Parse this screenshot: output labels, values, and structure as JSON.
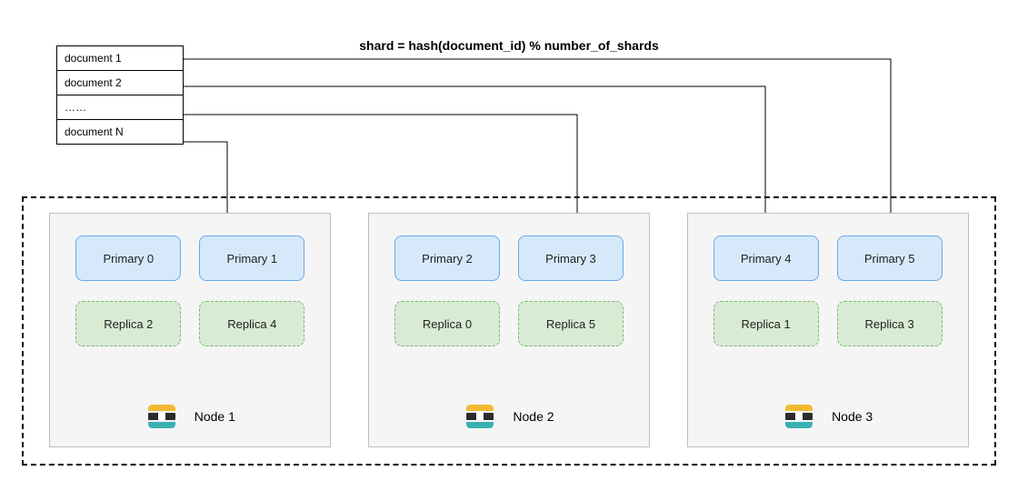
{
  "formula": "shard = hash(document_id) % number_of_shards",
  "documents": {
    "d1": "document 1",
    "d2": "document 2",
    "d3": "……",
    "d4": "document N"
  },
  "nodes": [
    {
      "label": "Node 1",
      "primaries": [
        "Primary 0",
        "Primary 1"
      ],
      "replicas": [
        "Replica 2",
        "Replica 4"
      ]
    },
    {
      "label": "Node 2",
      "primaries": [
        "Primary 2",
        "Primary 3"
      ],
      "replicas": [
        "Replica 0",
        "Replica 5"
      ]
    },
    {
      "label": "Node 3",
      "primaries": [
        "Primary 4",
        "Primary 5"
      ],
      "replicas": [
        "Replica 1",
        "Replica 3"
      ]
    }
  ],
  "logo_colors": {
    "yellow": "#f2b933",
    "dark": "#2b2b2b",
    "teal": "#3ab0b3",
    "white": "#ffffff"
  }
}
